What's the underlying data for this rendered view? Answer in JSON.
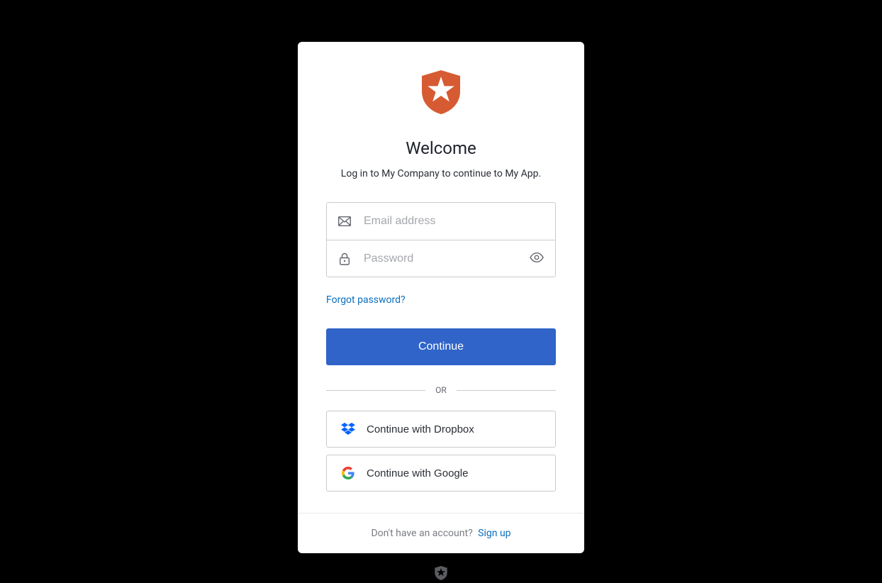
{
  "brand": {
    "logo_color": "#d65b33"
  },
  "heading": "Welcome",
  "subheading": "Log in to My Company to continue to My App.",
  "fields": {
    "email": {
      "placeholder": "Email address"
    },
    "password": {
      "placeholder": "Password"
    }
  },
  "links": {
    "forgot_password": "Forgot password?",
    "signup": "Sign up"
  },
  "buttons": {
    "continue": "Continue"
  },
  "divider_label": "OR",
  "social": {
    "dropbox": "Continue with Dropbox",
    "google": "Continue with Google"
  },
  "footer_prompt": "Don't have an account?"
}
